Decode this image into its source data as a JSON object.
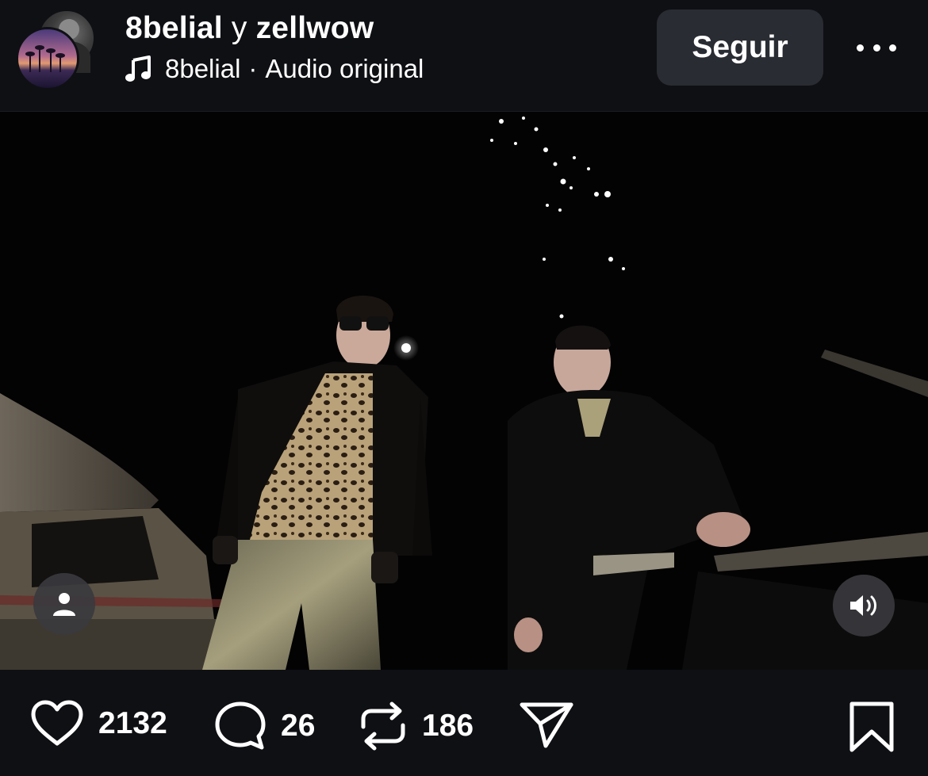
{
  "header": {
    "author_1": "8belial",
    "conjunction": "y",
    "author_2": "zellwow",
    "audio_artist": "8belial",
    "separator": "·",
    "audio_title": "Audio original",
    "follow_label": "Seguir"
  },
  "video": {
    "user_tag_icon": "person-icon",
    "sound_icon": "speaker-icon"
  },
  "actions": {
    "likes": "2132",
    "comments": "26",
    "reposts": "186",
    "like_icon": "heart-icon",
    "comment_icon": "comment-bubble-icon",
    "repost_icon": "repost-arrows-icon",
    "share_icon": "send-paper-plane-icon",
    "save_icon": "bookmark-icon"
  },
  "colors": {
    "background": "#0f1014",
    "button": "#2a2c33",
    "text": "#ffffff"
  }
}
